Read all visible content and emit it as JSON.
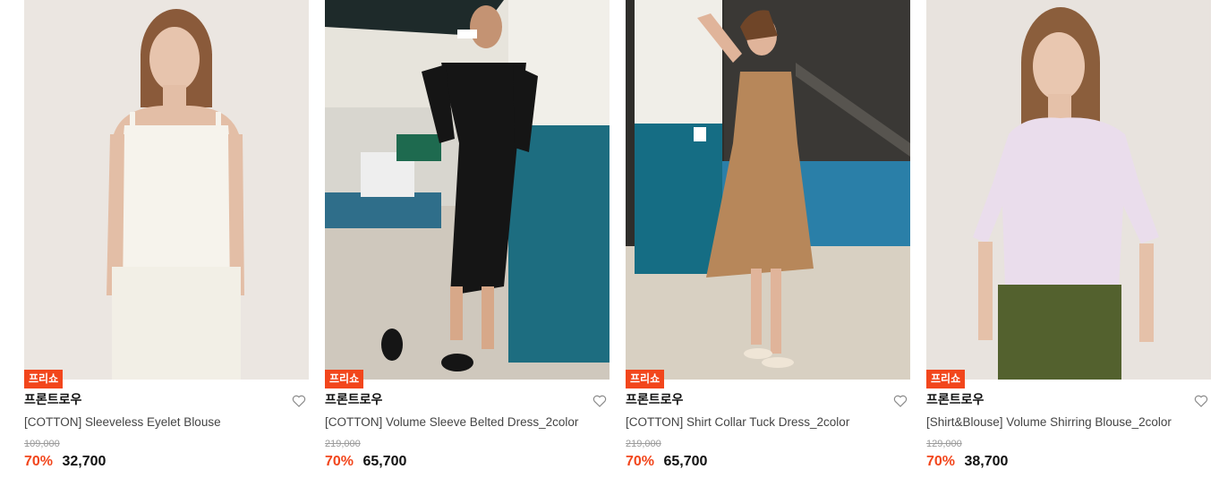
{
  "colors": {
    "accent": "#f2461c",
    "text": "#111111",
    "muted": "#9b9b9b"
  },
  "products": [
    {
      "badge": "프리쇼",
      "brand": "프론트로우",
      "name": "[COTTON] Sleeveless Eyelet Blouse",
      "original_price": "109,000",
      "discount": "70%",
      "price": "32,700"
    },
    {
      "badge": "프리쇼",
      "brand": "프론트로우",
      "name": "[COTTON] Volume Sleeve Belted Dress_2color",
      "original_price": "219,000",
      "discount": "70%",
      "price": "65,700"
    },
    {
      "badge": "프리쇼",
      "brand": "프론트로우",
      "name": "[COTTON] Shirt Collar Tuck Dress_2color",
      "original_price": "219,000",
      "discount": "70%",
      "price": "65,700"
    },
    {
      "badge": "프리쇼",
      "brand": "프론트로우",
      "name": "[Shirt&Blouse] Volume Shirring Blouse_2color",
      "original_price": "129,000",
      "discount": "70%",
      "price": "38,700"
    }
  ]
}
